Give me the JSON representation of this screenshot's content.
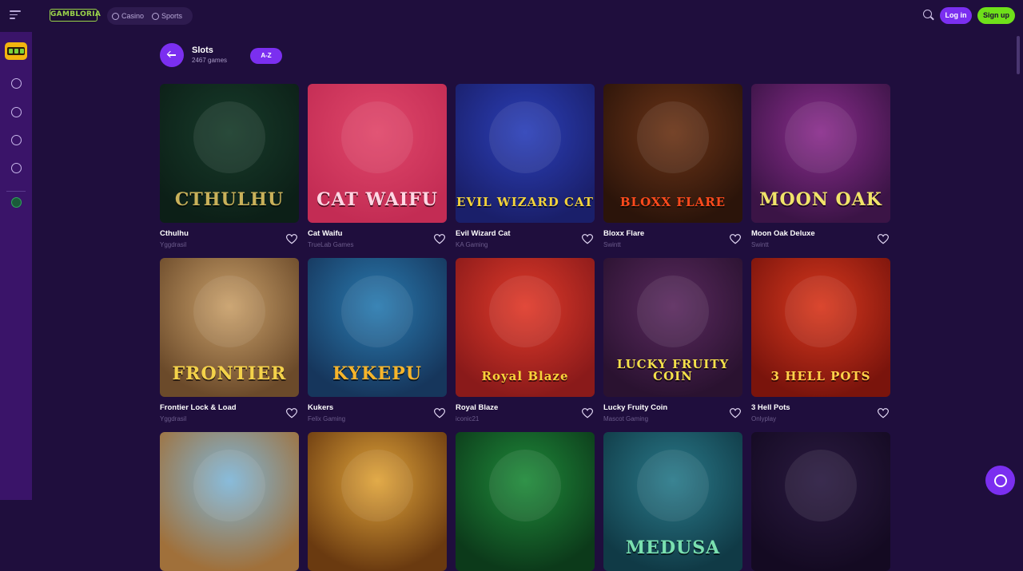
{
  "brand": {
    "logo_text": "GAMBLORIA"
  },
  "topbar": {
    "modes": [
      {
        "label": "Casino",
        "icon": "casino-icon"
      },
      {
        "label": "Sports",
        "icon": "sports-ball-icon"
      }
    ],
    "login_label": "Log in",
    "signup_label": "Sign up",
    "accent": "#7b2ff0",
    "signup_color": "#6fe01a"
  },
  "category": {
    "title": "Slots",
    "count": "2467 games",
    "sort_label": "A-Z"
  },
  "games": [
    {
      "name": "Cthulhu",
      "provider": "Yggdrasil",
      "art": "CTHULHU",
      "bg": [
        "#173b2a",
        "#0c1f17"
      ],
      "art_color": "#c9b15a"
    },
    {
      "name": "Cat Waifu",
      "provider": "TrueLab Games",
      "art": "CAT WAIFU",
      "bg": [
        "#e0476a",
        "#c32c54"
      ],
      "art_color": "#ffd7e4"
    },
    {
      "name": "Evil Wizard Cat",
      "provider": "KA Gaming",
      "art": "EVIL WIZARD CAT",
      "bg": [
        "#2b3fb8",
        "#1a1f6a"
      ],
      "art_color": "#f3d33b"
    },
    {
      "name": "Bloxx Flare",
      "provider": "Swintt",
      "art": "BLOXX FLARE",
      "bg": [
        "#6b3417",
        "#2b140a"
      ],
      "art_color": "#ff4a1c"
    },
    {
      "name": "Moon Oak Deluxe",
      "provider": "Swintt",
      "art": "MOON OAK",
      "bg": [
        "#8a2d8c",
        "#3b1446"
      ],
      "art_color": "#f1e36a"
    },
    {
      "name": "Frontier Lock & Load",
      "provider": "Yggdrasil",
      "art": "FRONTIER",
      "bg": [
        "#c9a06a",
        "#6b4a2a"
      ],
      "art_color": "#f4d24a"
    },
    {
      "name": "Kukers",
      "provider": "Felix Gaming",
      "art": "KYKEPU",
      "bg": [
        "#2a7bb0",
        "#16365c"
      ],
      "art_color": "#f6b52b"
    },
    {
      "name": "Royal Blaze",
      "provider": "iconic21",
      "art": "Royal Blaze",
      "bg": [
        "#e03a2a",
        "#8a1a1a"
      ],
      "art_color": "#f7d23a"
    },
    {
      "name": "Lucky Fruity Coin",
      "provider": "Mascot Gaming",
      "art": "LUCKY FRUITY COIN",
      "bg": [
        "#5a2a5e",
        "#2a1230"
      ],
      "art_color": "#f4e04a"
    },
    {
      "name": "3 Hell Pots",
      "provider": "Onlyplay",
      "art": "3 HELL POTS",
      "bg": [
        "#d8381e",
        "#7a140c"
      ],
      "art_color": "#ffd24a"
    },
    {
      "name": "",
      "provider": "",
      "art": "",
      "bg": [
        "#7fb6d8",
        "#a0703a"
      ],
      "art_color": "#fff"
    },
    {
      "name": "",
      "provider": "",
      "art": "",
      "bg": [
        "#e0a43a",
        "#6a3a10"
      ],
      "art_color": "#fff"
    },
    {
      "name": "",
      "provider": "",
      "art": "",
      "bg": [
        "#1f8a3a",
        "#0c3a1a"
      ],
      "art_color": "#fff"
    },
    {
      "name": "",
      "provider": "",
      "art": "MEDUSA",
      "bg": [
        "#2a7a8a",
        "#103a46"
      ],
      "art_color": "#7ae0b0"
    },
    {
      "name": "",
      "provider": "",
      "art": "",
      "bg": [
        "#2a1a40",
        "#140a22"
      ],
      "art_color": "#fff"
    }
  ]
}
